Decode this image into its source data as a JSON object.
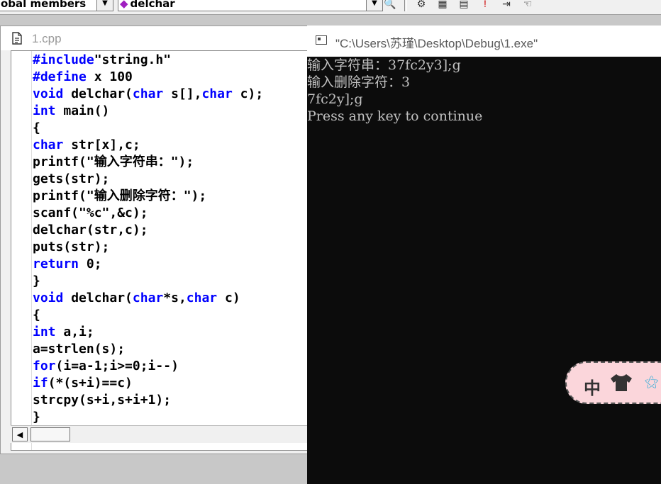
{
  "toolbar": {
    "members_combo": "obal members",
    "function_combo": "delchar"
  },
  "editor": {
    "tab_title": "1.cpp",
    "code_lines": [
      [
        {
          "t": "#include",
          "k": 1
        },
        {
          "t": "\"string.h\"",
          "k": 0
        }
      ],
      [
        {
          "t": "#define",
          "k": 1
        },
        {
          "t": " x 100",
          "k": 0
        }
      ],
      [
        {
          "t": "void",
          "k": 1
        },
        {
          "t": " delchar(",
          "k": 0
        },
        {
          "t": "char",
          "k": 1
        },
        {
          "t": " s[],",
          "k": 0
        },
        {
          "t": "char",
          "k": 1
        },
        {
          "t": " c);",
          "k": 0
        }
      ],
      [
        {
          "t": "int",
          "k": 1
        },
        {
          "t": " main()",
          "k": 0
        }
      ],
      [
        {
          "t": "{",
          "k": 0
        }
      ],
      [
        {
          "t": "char",
          "k": 1
        },
        {
          "t": " str[x],c;",
          "k": 0
        }
      ],
      [
        {
          "t": "printf(\"输入字符串：\");",
          "k": 0
        }
      ],
      [
        {
          "t": "gets(str);",
          "k": 0
        }
      ],
      [
        {
          "t": "printf(\"输入删除字符：\");",
          "k": 0
        }
      ],
      [
        {
          "t": "scanf(\"%c\",&c);",
          "k": 0
        }
      ],
      [
        {
          "t": "delchar(str,c);",
          "k": 0
        }
      ],
      [
        {
          "t": "puts(str);",
          "k": 0
        }
      ],
      [
        {
          "t": "return",
          "k": 1
        },
        {
          "t": " 0;",
          "k": 0
        }
      ],
      [
        {
          "t": "}",
          "k": 0
        }
      ],
      [
        {
          "t": "void",
          "k": 1
        },
        {
          "t": " delchar(",
          "k": 0
        },
        {
          "t": "char",
          "k": 1
        },
        {
          "t": "*s,",
          "k": 0
        },
        {
          "t": "char",
          "k": 1
        },
        {
          "t": " c)",
          "k": 0
        }
      ],
      [
        {
          "t": "{",
          "k": 0
        }
      ],
      [
        {
          "t": "int",
          "k": 1
        },
        {
          "t": " a,i;",
          "k": 0
        }
      ],
      [
        {
          "t": "a=strlen(s);",
          "k": 0
        }
      ],
      [
        {
          "t": "for",
          "k": 1
        },
        {
          "t": "(i=a-1;i>=0;i--)",
          "k": 0
        }
      ],
      [
        {
          "t": "if",
          "k": 1
        },
        {
          "t": "(*(s+i)==c)",
          "k": 0
        }
      ],
      [
        {
          "t": "strcpy(s+i,s+i+1);",
          "k": 0
        }
      ],
      [
        {
          "t": "}",
          "k": 0
        }
      ]
    ],
    "keyword_color": "#0000ff"
  },
  "console": {
    "title": "\"C:\\Users\\苏瑾\\Desktop\\Debug\\1.exe\"",
    "output_lines": [
      "输入字符串：37fc2y3];g",
      "输入删除字符：3",
      "7fc2y];g",
      "Press any key to continue"
    ]
  },
  "ime": {
    "mode_label": "中"
  }
}
